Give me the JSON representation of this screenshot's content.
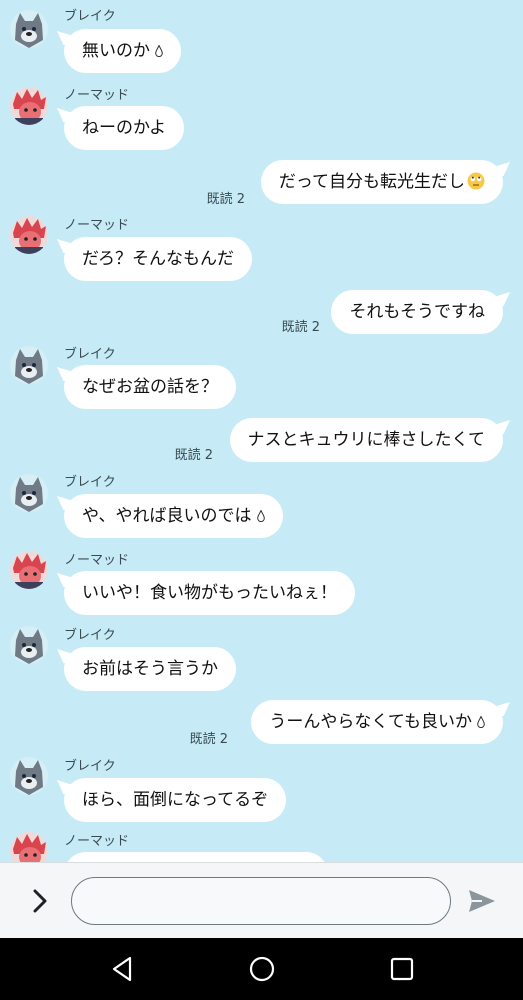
{
  "contacts": {
    "blake": "ブレイク",
    "nomad": "ノーマッド"
  },
  "read_label": "既読 2",
  "messages": {
    "m1": "無いのか",
    "m2": "ねーのかよ",
    "m3": "だって自分も転光生だし",
    "m4": "だろ？そんなもんだ",
    "m5": "それもそうですね",
    "m6": "なぜお盆の話を？",
    "m7": "ナスとキュウリに棒さしたくて",
    "m8": "や、やれば良いのでは",
    "m9": "いいや！食い物がもったいねぇ！",
    "m10": "お前はそう言うか",
    "m11": "うーんやらなくても良いか",
    "m12": "ほら、面倒になってるぞ"
  },
  "input": {
    "placeholder": "",
    "value": ""
  },
  "icons": {
    "expand": "chevron-right-icon",
    "send": "send-icon",
    "sweat": "sweat-drop-icon",
    "emoji": "rolling-eyes-emoji-icon",
    "nav_back": "back-triangle-icon",
    "nav_home": "home-circle-icon",
    "nav_recent": "recent-square-icon"
  },
  "colors": {
    "chat_bg": "#c6ebf7",
    "bubble": "#ffffff",
    "nav_bg": "#000000",
    "send": "#8a969b"
  }
}
